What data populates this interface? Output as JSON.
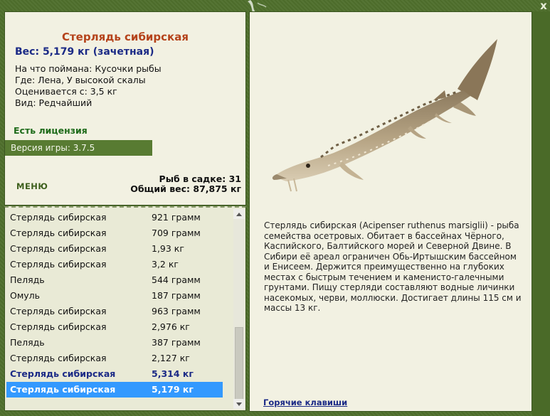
{
  "window": {
    "close_label": "x"
  },
  "fish": {
    "title": "Стерлядь сибирская",
    "weight": "Вес: 5,179 кг (зачетная)",
    "bait": "На что поймана: Кусочки рыбы",
    "place": "Где: Лена, У высокой скалы",
    "value": "Оценивается с: 3,5 кг",
    "kind": "Вид: Редчайший"
  },
  "license_text": "Есть лицензия",
  "version_text": "Версия игры: 3.7.5",
  "menu_label": "МЕНЮ",
  "keep_net": {
    "count": "Рыб в садке: 31",
    "total": "Общий вес: 87,875 кг"
  },
  "catch_list": [
    {
      "name": "Стерлядь сибирская",
      "weight": "921 грамм"
    },
    {
      "name": "Стерлядь сибирская",
      "weight": "709 грамм"
    },
    {
      "name": "Стерлядь сибирская",
      "weight": "1,93 кг"
    },
    {
      "name": "Стерлядь сибирская",
      "weight": "3,2 кг"
    },
    {
      "name": "Пелядь",
      "weight": "544 грамм"
    },
    {
      "name": "Омуль",
      "weight": "187 грамм"
    },
    {
      "name": "Стерлядь сибирская",
      "weight": "963 грамм"
    },
    {
      "name": "Стерлядь сибирская",
      "weight": "2,976 кг"
    },
    {
      "name": "Пелядь",
      "weight": "387 грамм"
    },
    {
      "name": "Стерлядь сибирская",
      "weight": "2,127 кг"
    },
    {
      "name": "Стерлядь сибирская",
      "weight": "5,314 кг"
    },
    {
      "name": "Стерлядь сибирская",
      "weight": "5,179 кг"
    }
  ],
  "description": "Стерлядь сибирская (Acipenser ruthenus marsiglii) - рыба семейства осетровых. Обитает в бассейнах Чёрного, Каспийского, Балтийского морей и Северной Двине. В Сибири её ареал ограничен Обь-Иртышским бассейном и Енисеем. Держится преимущественно на глубоких местах с быстрым течением и каменисто-галечными грунтами. Пищу стерляди составляют водные личинки насекомых, черви, моллюски. Достигает длины 115 см и массы 13 кг.",
  "hotkeys_label": "Горячие клавиши",
  "icons": {
    "close": "close-icon",
    "scroll_up": "arrow-up-icon",
    "scroll_down": "arrow-down-icon",
    "fish": "sterlet-fish-image"
  },
  "colors": {
    "frame": "#50702d",
    "panel": "#f2f1e2",
    "title": "#b5431b",
    "accent_blue": "#1b2a86",
    "selection": "#3399ff",
    "license": "#1e6b1a"
  }
}
